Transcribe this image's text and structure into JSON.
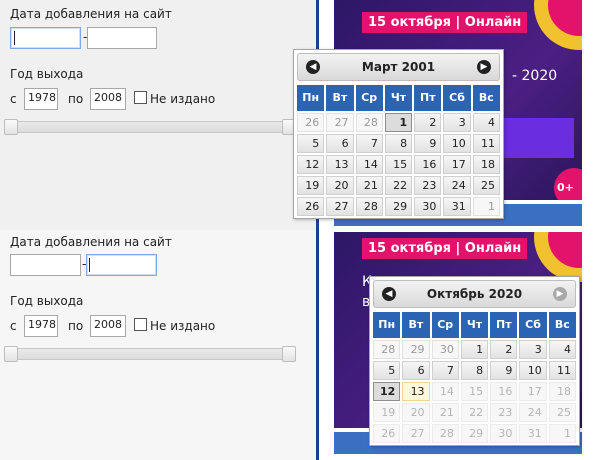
{
  "top_form": {
    "added_label": "Дата добавления на сайт",
    "dash": "-",
    "year_label": "Год выхода",
    "from_label": "с",
    "from_value": "1978",
    "to_label": "по",
    "to_value": "2008",
    "unpublished_label": "Не издано"
  },
  "bottom_form": {
    "added_label": "Дата добавления на сайт",
    "dash": "-",
    "year_label": "Год выхода",
    "from_label": "с",
    "from_value": "1978",
    "to_label": "по",
    "to_value": "2008",
    "unpublished_label": "Не издано"
  },
  "ads": {
    "tag1": "15 октября | Онлайн",
    "tag2": "15 октября | Онлайн",
    "year_frag": "- 2020",
    "badge": "0+",
    "frag_k": "К",
    "frag_b": "в",
    "colors": {
      "tag": "#e3136b",
      "bg": "#3a1a6e",
      "button": "#3a6fc2"
    }
  },
  "calendar1": {
    "title": "Март 2001",
    "prev": "◀",
    "next": "▶",
    "dow": [
      "Пн",
      "Вт",
      "Ср",
      "Чт",
      "Пт",
      "Сб",
      "Вс"
    ],
    "days": [
      "26",
      "27",
      "28",
      "1",
      "2",
      "3",
      "4",
      "5",
      "6",
      "7",
      "8",
      "9",
      "10",
      "11",
      "12",
      "13",
      "14",
      "15",
      "16",
      "17",
      "18",
      "19",
      "20",
      "21",
      "22",
      "23",
      "24",
      "25",
      "26",
      "27",
      "28",
      "29",
      "30",
      "31",
      "1"
    ],
    "other": [
      0,
      1,
      2,
      34
    ],
    "selected": 3
  },
  "calendar2": {
    "title": "Октябрь 2020",
    "prev": "◀",
    "next": "▶",
    "dow": [
      "Пн",
      "Вт",
      "Ср",
      "Чт",
      "Пт",
      "Сб",
      "Вс"
    ],
    "days": [
      "28",
      "29",
      "30",
      "1",
      "2",
      "3",
      "4",
      "5",
      "6",
      "7",
      "8",
      "9",
      "10",
      "11",
      "12",
      "13",
      "14",
      "15",
      "16",
      "17",
      "18",
      "19",
      "20",
      "21",
      "22",
      "23",
      "24",
      "25",
      "26",
      "27",
      "28",
      "29",
      "30",
      "31",
      "1"
    ],
    "other": [
      0,
      1,
      2,
      34
    ],
    "selected": 14,
    "today": 15,
    "disabled_from": 16
  }
}
